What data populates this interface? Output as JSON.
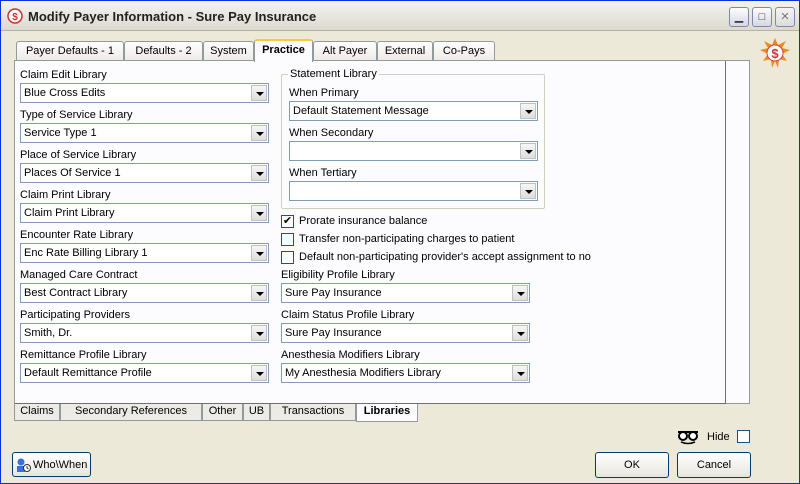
{
  "window": {
    "title": "Modify Payer Information - Sure Pay Insurance"
  },
  "tabs": [
    {
      "label": "Payer Defaults - 1"
    },
    {
      "label": "Defaults - 2"
    },
    {
      "label": "System"
    },
    {
      "label": "Practice"
    },
    {
      "label": "Alt Payer"
    },
    {
      "label": "External"
    },
    {
      "label": "Co-Pays"
    }
  ],
  "left_fields": [
    {
      "label": "Claim Edit Library",
      "value": "Blue Cross Edits"
    },
    {
      "label": "Type of Service Library",
      "value": "Service Type 1"
    },
    {
      "label": "Place of Service Library",
      "value": "Places Of Service 1"
    },
    {
      "label": "Claim Print Library",
      "value": "Claim Print Library"
    },
    {
      "label": "Encounter Rate Library",
      "value": "Enc Rate Billing Library 1"
    },
    {
      "label": "Managed Care Contract",
      "value": "Best Contract Library"
    },
    {
      "label": "Participating Providers",
      "value": "Smith, Dr."
    },
    {
      "label": "Remittance Profile Library",
      "value": "Default Remittance Profile"
    }
  ],
  "statement": {
    "legend": "Statement Library",
    "fields": [
      {
        "label": "When Primary",
        "value": "Default Statement Message"
      },
      {
        "label": "When Secondary",
        "value": ""
      },
      {
        "label": "When Tertiary",
        "value": ""
      }
    ]
  },
  "checks": [
    {
      "label": "Prorate insurance balance",
      "checked": true
    },
    {
      "label": "Transfer non-participating charges to patient",
      "checked": false
    },
    {
      "label": "Default non-participating provider's accept assignment to no",
      "checked": false
    }
  ],
  "right_fields": [
    {
      "label": "Eligibility Profile Library",
      "value": "Sure Pay Insurance"
    },
    {
      "label": "Claim Status Profile Library",
      "value": "Sure Pay Insurance"
    },
    {
      "label": "Anesthesia Modifiers Library",
      "value": "My Anesthesia Modifiers Library"
    }
  ],
  "bottom_tabs": [
    {
      "label": "Claims"
    },
    {
      "label": "Secondary References"
    },
    {
      "label": "Other"
    },
    {
      "label": "UB"
    },
    {
      "label": "Transactions"
    },
    {
      "label": "Libraries"
    }
  ],
  "footer": {
    "hide_label": "Hide",
    "whowhen_label": "Who\\When",
    "ok_label": "OK",
    "cancel_label": "Cancel"
  },
  "icons": [
    "app-icon",
    "minimize-icon",
    "maximize-icon",
    "close-icon",
    "dollar-logo-icon",
    "glasses-icon",
    "whowhen-icon",
    "dropdown-arrow-icon"
  ],
  "colors": {
    "tab_highlight": "#ffc83c",
    "accent_blue": "#0831d9",
    "logo_orange": "#f08a1c"
  }
}
